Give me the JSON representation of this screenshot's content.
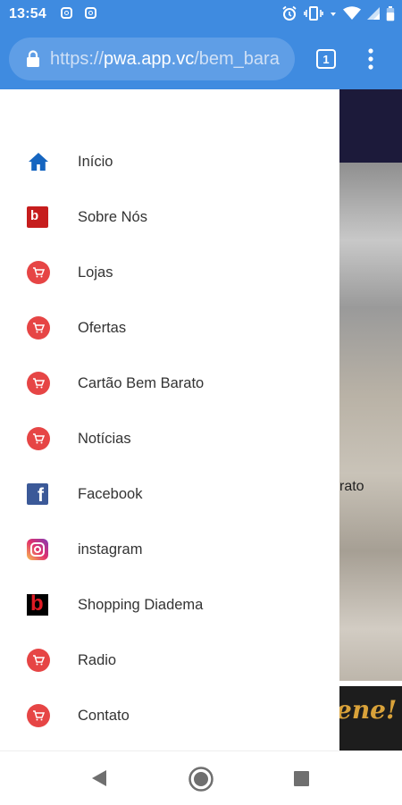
{
  "status_bar": {
    "time": "13:54",
    "left_icons": [
      "instagram-icon",
      "instagram-icon"
    ],
    "right_icons": [
      "alarm-icon",
      "vibrate-icon",
      "data-arrows-icon",
      "wifi-icon",
      "signal-icon",
      "battery-icon"
    ]
  },
  "browser": {
    "url": "https://pwa.app.vc/bem_barato",
    "url_scheme": "https://",
    "url_host": "pwa.app.vc",
    "url_path": "/bem_bara",
    "tab_count": "1"
  },
  "drawer": {
    "items": [
      {
        "label": "Início",
        "icon": "home-icon"
      },
      {
        "label": "Sobre Nós",
        "icon": "bem-barato-logo-icon"
      },
      {
        "label": "Lojas",
        "icon": "cart-icon"
      },
      {
        "label": "Ofertas",
        "icon": "cart-icon"
      },
      {
        "label": "Cartão Bem Barato",
        "icon": "cart-icon"
      },
      {
        "label": "Notícias",
        "icon": "cart-icon"
      },
      {
        "label": "Facebook",
        "icon": "facebook-icon"
      },
      {
        "label": "instagram",
        "icon": "instagram-icon"
      },
      {
        "label": "Shopping Diadema",
        "icon": "shopping-diadema-logo-icon"
      },
      {
        "label": "Radio",
        "icon": "cart-icon"
      },
      {
        "label": "Contato",
        "icon": "cart-icon"
      }
    ]
  },
  "background_page": {
    "partial_text": "rato",
    "banner_text": "ene!"
  },
  "colors": {
    "chrome_blue": "#3f8be0",
    "cart_red": "#e64545",
    "home_blue": "#1565c0"
  }
}
